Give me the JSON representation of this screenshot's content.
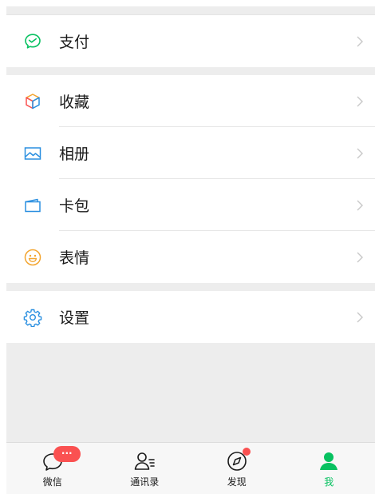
{
  "menu": {
    "groups": [
      [
        {
          "id": "pay",
          "label": "支付",
          "icon": "wechat-pay-icon"
        }
      ],
      [
        {
          "id": "favorites",
          "label": "收藏",
          "icon": "cube-icon"
        },
        {
          "id": "album",
          "label": "相册",
          "icon": "picture-icon"
        },
        {
          "id": "cards",
          "label": "卡包",
          "icon": "wallet-icon"
        },
        {
          "id": "stickers",
          "label": "表情",
          "icon": "smiley-icon"
        }
      ],
      [
        {
          "id": "settings",
          "label": "设置",
          "icon": "gear-icon"
        }
      ]
    ]
  },
  "tabbar": {
    "tabs": [
      {
        "label": "微信",
        "icon": "chat-bubble-icon",
        "badge": "···",
        "active": false
      },
      {
        "label": "通讯录",
        "icon": "contacts-icon",
        "active": false
      },
      {
        "label": "发现",
        "icon": "compass-icon",
        "dot": true,
        "active": false
      },
      {
        "label": "我",
        "icon": "person-icon",
        "active": true
      }
    ]
  },
  "colors": {
    "accent": "#07c160",
    "badge": "#fa5151",
    "blue": "#2a8fe0",
    "orange": "#f3a530"
  }
}
